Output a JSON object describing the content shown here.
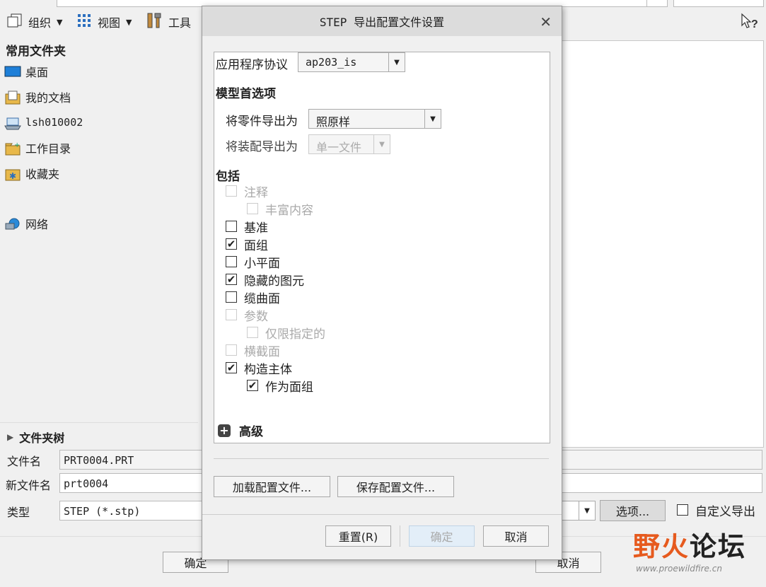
{
  "toolbar": {
    "organize": "组织",
    "view": "视图",
    "tools": "工具"
  },
  "folders": {
    "title": "常用文件夹",
    "items": [
      "桌面",
      "我的文档",
      "lsh010002",
      "工作目录",
      "收藏夹",
      "网络"
    ],
    "tree_label": "文件夹树"
  },
  "form": {
    "filename_label": "文件名",
    "filename_value": "PRT0004.PRT",
    "newname_label": "新文件名",
    "newname_value": "prt0004",
    "type_label": "类型",
    "type_value": "STEP (*.stp)",
    "options_button": "选项...",
    "custom_export_label": "自定义导出",
    "ok_button": "确定",
    "cancel_button": "取消"
  },
  "dialog": {
    "title": "STEP 导出配置文件设置",
    "app_protocol_label": "应用程序协议",
    "app_protocol_value": "ap203_is",
    "model_prefs_title": "模型首选项",
    "part_export_label": "将零件导出为",
    "part_export_value": "照原样",
    "asm_export_label": "将装配导出为",
    "asm_export_value": "单一文件",
    "include_title": "包括",
    "checkboxes": [
      {
        "label": "注释",
        "checked": false,
        "disabled": true,
        "indent": 0
      },
      {
        "label": "丰富内容",
        "checked": false,
        "disabled": true,
        "indent": 1
      },
      {
        "label": "基准",
        "checked": false,
        "disabled": false,
        "indent": 0
      },
      {
        "label": "面组",
        "checked": true,
        "disabled": false,
        "indent": 0
      },
      {
        "label": "小平面",
        "checked": false,
        "disabled": false,
        "indent": 0
      },
      {
        "label": "隐藏的图元",
        "checked": true,
        "disabled": false,
        "indent": 0
      },
      {
        "label": "缆曲面",
        "checked": false,
        "disabled": false,
        "indent": 0
      },
      {
        "label": "参数",
        "checked": false,
        "disabled": true,
        "indent": 0
      },
      {
        "label": "仅限指定的",
        "checked": false,
        "disabled": true,
        "indent": 1
      },
      {
        "label": "横截面",
        "checked": false,
        "disabled": true,
        "indent": 0
      },
      {
        "label": "构造主体",
        "checked": true,
        "disabled": false,
        "indent": 0
      },
      {
        "label": "作为面组",
        "checked": true,
        "disabled": false,
        "indent": 1
      }
    ],
    "advanced_label": "高级",
    "load_config_button": "加载配置文件...",
    "save_config_button": "保存配置文件...",
    "reset_button": "重置(R)",
    "ok_button": "确定",
    "cancel_button": "取消"
  },
  "watermark": {
    "text": "野火论坛",
    "url": "www.proewildfire.cn"
  },
  "colors": {
    "accent": "#e65a1e",
    "folder_blue": "#1e7fd8",
    "folder_yellow": "#e8b84a"
  }
}
